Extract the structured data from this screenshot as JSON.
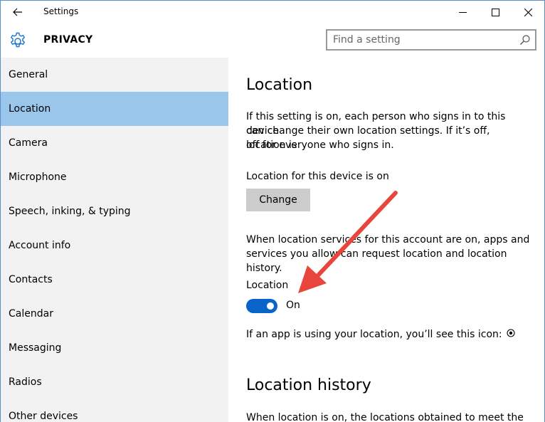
{
  "window": {
    "title": "Settings"
  },
  "header": {
    "title": "PRIVACY",
    "search_placeholder": "Find a setting"
  },
  "sidebar": {
    "items": [
      {
        "label": "General"
      },
      {
        "label": "Location",
        "active": true
      },
      {
        "label": "Camera"
      },
      {
        "label": "Microphone"
      },
      {
        "label": "Speech, inking, & typing"
      },
      {
        "label": "Account info"
      },
      {
        "label": "Contacts"
      },
      {
        "label": "Calendar"
      },
      {
        "label": "Messaging"
      },
      {
        "label": "Radios"
      },
      {
        "label": "Other devices"
      }
    ]
  },
  "content": {
    "heading": "Location",
    "intro_line1": "If this setting is on, each person who signs in to this device",
    "intro_line2": "can change their own location settings. If it’s off, location is",
    "intro_line3": "off for everyone who signs in.",
    "device_status": "Location for this device is on",
    "change_label": "Change",
    "services_line1": "When location services for this account are on, apps and",
    "services_line2": "services you allow can request location and location history.",
    "toggle_title": "Location",
    "toggle_state": "On",
    "icon_note": "If an app is using your location, you’ll see this icon:",
    "history_heading": "Location history",
    "history_text": "When location is on, the locations obtained to meet the"
  },
  "colors": {
    "active_item": "#9ac6eb",
    "sidebar_bg": "#f2f2f2",
    "toggle_on": "#0a63c9",
    "annotation_arrow": "#e8453c"
  }
}
